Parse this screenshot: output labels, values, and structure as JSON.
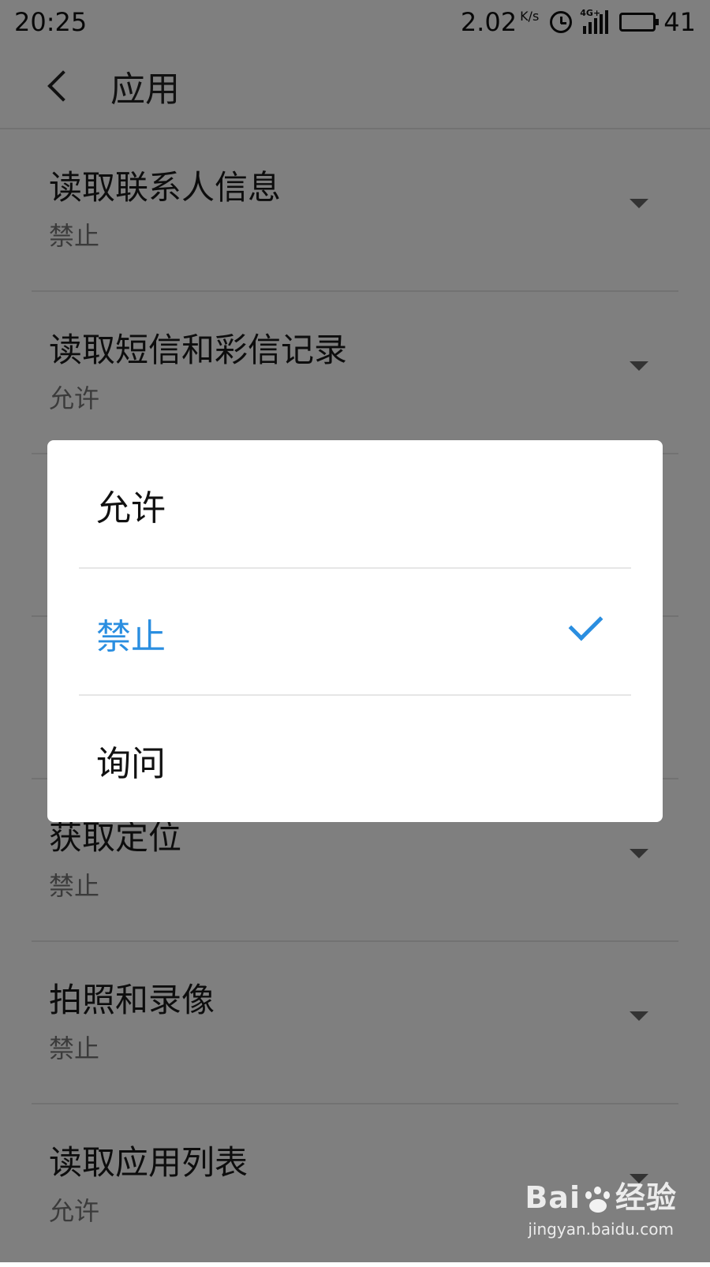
{
  "status_bar": {
    "time": "20:25",
    "speed": "2.02",
    "speed_unit": "K/s",
    "network": "4G+",
    "battery": "41"
  },
  "header": {
    "title": "应用"
  },
  "permissions": [
    {
      "title": "读取联系人信息",
      "value": "禁止"
    },
    {
      "title": "读取短信和彩信记录",
      "value": "允许"
    },
    {
      "title": "",
      "value": ""
    },
    {
      "title": "",
      "value": ""
    },
    {
      "title": "获取定位",
      "value": "禁止"
    },
    {
      "title": "拍照和录像",
      "value": "禁止"
    },
    {
      "title": "读取应用列表",
      "value": "允许"
    }
  ],
  "dialog": {
    "options": [
      {
        "label": "允许",
        "selected": false
      },
      {
        "label": "禁止",
        "selected": true
      },
      {
        "label": "询问",
        "selected": false
      }
    ],
    "accent_color": "#2a8ee0"
  },
  "watermark": {
    "brand_left": "Bai",
    "brand_right": "经验",
    "site": "jingyan.baidu.com"
  }
}
